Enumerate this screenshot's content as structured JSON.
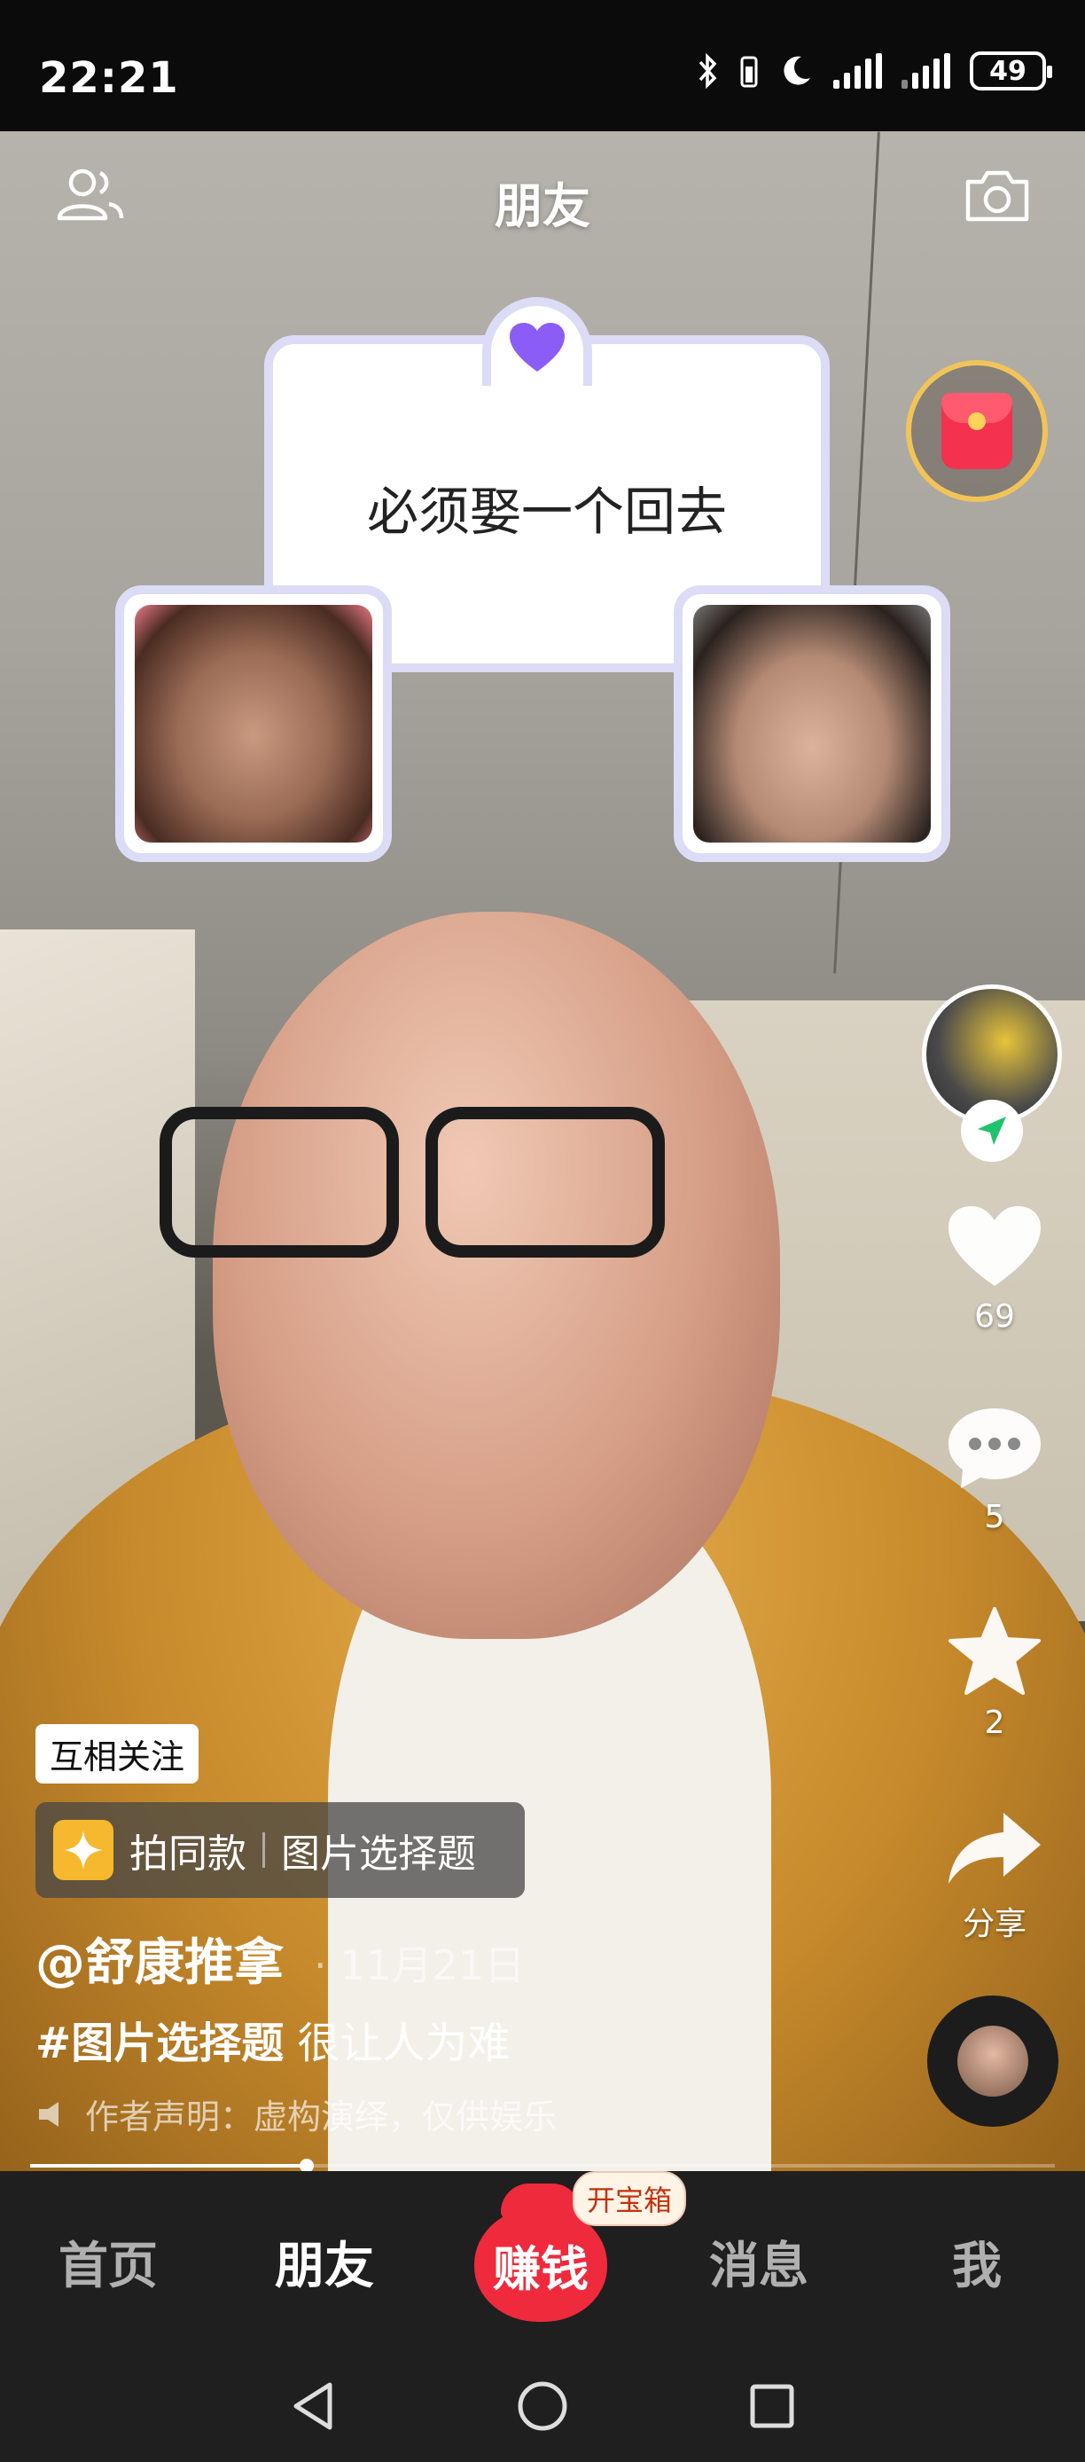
{
  "status_bar": {
    "time": "22:21",
    "battery": "49",
    "icons": [
      "bluetooth-icon",
      "battery-saver-icon",
      "moon-icon",
      "signal-icon",
      "signal-icon"
    ]
  },
  "top_bar": {
    "title": "朋友",
    "left_icon": "friends-icon",
    "right_icon": "camera-icon"
  },
  "quiz": {
    "question": "必须娶一个回去",
    "heart_color": "#8b5cf6"
  },
  "right_rail": {
    "like_count": "69",
    "comment_count": "5",
    "favorite_count": "2",
    "share_label": "分享"
  },
  "caption": {
    "mutual_tag": "互相关注",
    "template_label": "拍同款",
    "template_topic": "图片选择题",
    "author": "@舒康推拿",
    "date": "· 11月21日",
    "hashtag": "#图片选择题",
    "text": "很让人为难",
    "disclaimer": "作者声明：虚构演绎，仅供娱乐"
  },
  "playback": {
    "progress": 0.27
  },
  "bottom_nav": {
    "home": "首页",
    "friends": "朋友",
    "earn": "赚钱",
    "earn_badge": "开宝箱",
    "messages": "消息",
    "me": "我"
  },
  "colors": {
    "accent_red": "#ee2a3c",
    "gold_ring": "#f2c458",
    "follow_green": "#1ec46b"
  }
}
